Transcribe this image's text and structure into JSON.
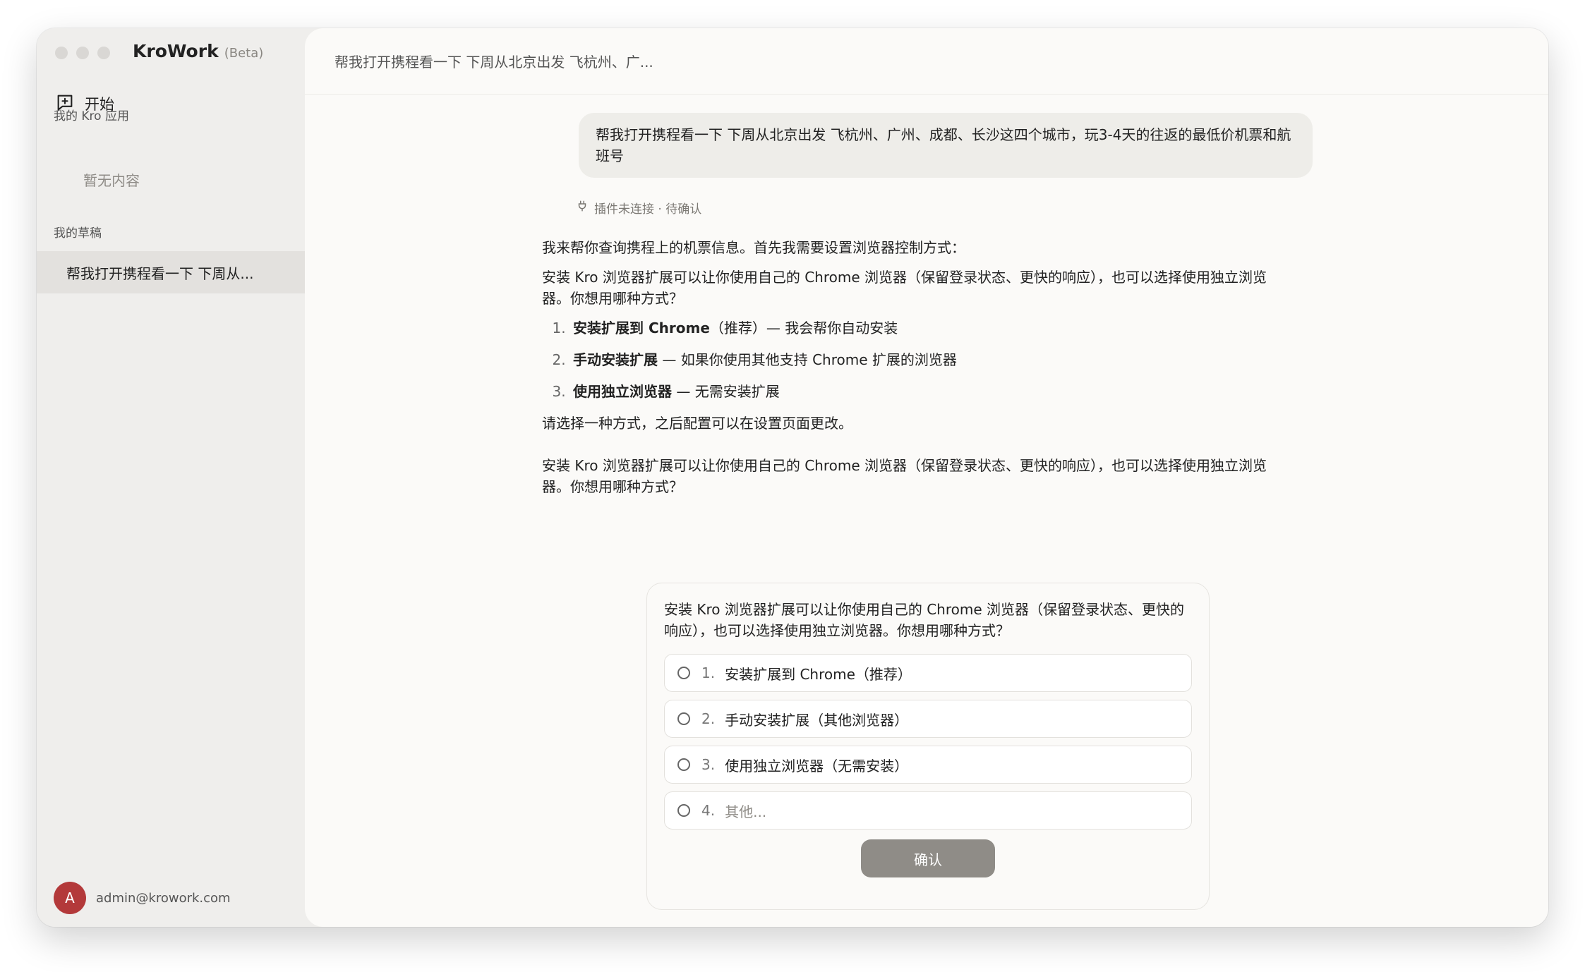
{
  "app": {
    "title": "KroWork",
    "badge": "(Beta)"
  },
  "sidebar": {
    "new_chat_label": "开始",
    "apps_section_label": "我的 Kro 应用",
    "apps_empty": "暂无内容",
    "drafts_section_label": "我的草稿",
    "drafts": [
      {
        "label": "帮我打开携程看一下 下周从..."
      }
    ],
    "user": {
      "initial": "A",
      "email": "admin@krowork.com"
    }
  },
  "main": {
    "header_title": "帮我打开携程看一下 下周从北京出发 飞杭州、广...",
    "user_message": "帮我打开携程看一下 下周从北京出发 飞杭州、广州、成都、长沙这四个城市，玩3-4天的往返的最低价机票和航班号",
    "plugin_status": "插件未连接 · 待确认",
    "assistant": {
      "intro": "我来帮你查询携程上的机票信息。首先我需要设置浏览器控制方式：",
      "explain": "安装 Kro 浏览器扩展可以让你使用自己的 Chrome 浏览器（保留登录状态、更快的响应），也可以选择使用独立浏览器。你想用哪种方式？",
      "options": [
        {
          "bold": "安装扩展到 Chrome",
          "rest": "（推荐）— 我会帮你自动安装"
        },
        {
          "bold": "手动安装扩展",
          "rest": " — 如果你使用其他支持 Chrome 扩展的浏览器"
        },
        {
          "bold": "使用独立浏览器",
          "rest": " — 无需安装扩展"
        }
      ],
      "closing": "请选择一种方式，之后配置可以在设置页面更改。",
      "repeat": "安装 Kro 浏览器扩展可以让你使用自己的 Chrome 浏览器（保留登录状态、更快的响应），也可以选择使用独立浏览器。你想用哪种方式？"
    }
  },
  "card": {
    "question": "安装 Kro 浏览器扩展可以让你使用自己的 Chrome 浏览器（保留登录状态、更快的响应），也可以选择使用独立浏览器。你想用哪种方式？",
    "options": [
      {
        "num": "1.",
        "label": "安装扩展到 Chrome（推荐）"
      },
      {
        "num": "2.",
        "label": "手动安装扩展（其他浏览器）"
      },
      {
        "num": "3.",
        "label": "使用独立浏览器（无需安装）"
      },
      {
        "num": "4.",
        "label": "其他..."
      }
    ],
    "confirm_label": "确认"
  },
  "colors": {
    "sidebar_bg": "#efeeec",
    "main_bg": "#fbfaf8",
    "avatar": "#b3393a",
    "confirm_button": "#8f8c87"
  }
}
